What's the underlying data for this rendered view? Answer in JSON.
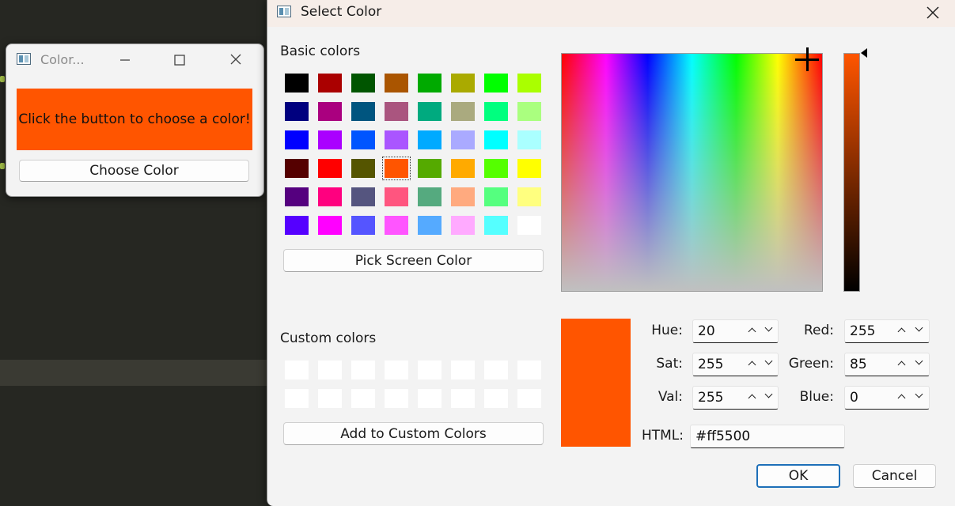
{
  "small_window": {
    "title": "Color...",
    "message": "Click the button to choose a color!",
    "choose_button": "Choose Color",
    "swatch_color": "#ff5500"
  },
  "dialog": {
    "title": "Select Color",
    "basic_colors_label": "Basic colors",
    "basic_colors": [
      [
        "#000000",
        "#aa0000",
        "#005500",
        "#aa5500",
        "#00aa00",
        "#aaaa00",
        "#00ff00",
        "#aaff00"
      ],
      [
        "#00007f",
        "#aa007f",
        "#00557f",
        "#aa557f",
        "#00aa7f",
        "#aaaa7f",
        "#00ff7f",
        "#aaff7f"
      ],
      [
        "#0000ff",
        "#aa00ff",
        "#0055ff",
        "#aa55ff",
        "#00aaff",
        "#aaaaff",
        "#00ffff",
        "#aaffff"
      ],
      [
        "#550000",
        "#ff0000",
        "#555500",
        "#ff5500",
        "#55aa00",
        "#ffaa00",
        "#55ff00",
        "#ffff00"
      ],
      [
        "#55007f",
        "#ff007f",
        "#55557f",
        "#ff557f",
        "#55aa7f",
        "#ffaa7f",
        "#55ff7f",
        "#ffff7f"
      ],
      [
        "#5500ff",
        "#ff00ff",
        "#5555ff",
        "#ff55ff",
        "#55aaff",
        "#ffaaff",
        "#55ffff",
        "#ffffff"
      ]
    ],
    "selected_basic": {
      "row": 3,
      "col": 3
    },
    "pick_screen_button": "Pick Screen Color",
    "custom_colors_label": "Custom colors",
    "custom_colors_rows": 2,
    "custom_colors_cols": 8,
    "add_custom_button": "Add to Custom Colors",
    "current_color": "#ff5500",
    "fields": {
      "hue": {
        "label": "Hue:",
        "value": "20"
      },
      "sat": {
        "label": "Sat:",
        "value": "255"
      },
      "val": {
        "label": "Val:",
        "value": "255"
      },
      "red": {
        "label": "Red:",
        "value": "255"
      },
      "green": {
        "label": "Green:",
        "value": "85"
      },
      "blue": {
        "label": "Blue:",
        "value": "0"
      }
    },
    "html_label": "HTML:",
    "html_value": "#ff5500",
    "ok_button": "OK",
    "cancel_button": "Cancel",
    "value_level": 1.0
  }
}
